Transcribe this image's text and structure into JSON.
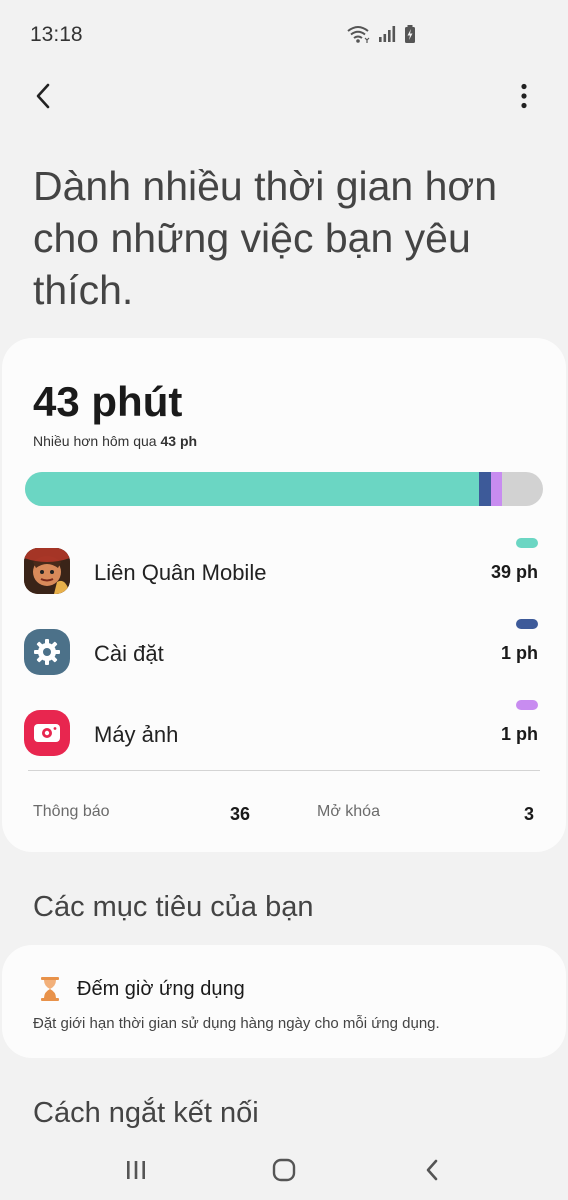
{
  "status_bar": {
    "time": "13:18"
  },
  "headline": "Dành nhiều thời gian hơn cho những việc bạn yêu thích.",
  "usage": {
    "total": "43 phút",
    "compare_prefix": "Nhiều hơn hôm qua",
    "compare_value": "43 ph",
    "bar_colors": {
      "track": "#d2d2d2"
    },
    "apps": [
      {
        "name": "Liên Quân Mobile",
        "time": "39 ph",
        "minutes": 39,
        "color": "#6bd6c3",
        "icon": "game-app-icon"
      },
      {
        "name": "Cài đặt",
        "time": "1 ph",
        "minutes": 1,
        "color": "#3d5a99",
        "icon": "settings-gear-icon"
      },
      {
        "name": "Máy ảnh",
        "time": "1 ph",
        "minutes": 1,
        "color": "#c88cf0",
        "icon": "camera-icon"
      }
    ],
    "notifications_label": "Thông báo",
    "notifications_value": "36",
    "unlocks_label": "Mở khóa",
    "unlocks_value": "3"
  },
  "goals": {
    "title": "Các mục tiêu của bạn",
    "app_timer_title": "Đếm giờ ứng dụng",
    "app_timer_desc": "Đặt giới hạn thời gian sử dụng hàng ngày cho mỗi ứng dụng.",
    "app_timer_icon": "hourglass-icon"
  },
  "disconnect": {
    "title": "Cách ngắt kết nối"
  }
}
